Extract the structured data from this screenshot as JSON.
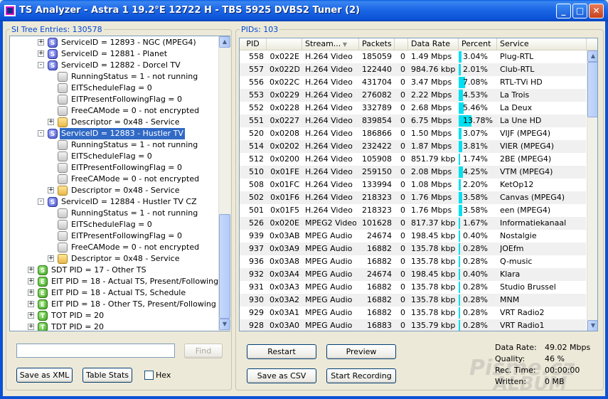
{
  "window": {
    "title": "TS Analyzer - Astra 1 19.2°E 12722 H - TBS 5925 DVBS2 Tuner (2)",
    "minimize": "_",
    "maximize": "□",
    "close": "✕"
  },
  "left_panel": {
    "label": "SI Tree Entries: 130578",
    "tree": [
      {
        "text": "ServiceID = 12893 - NGC (MPEG4)",
        "level": 1,
        "icon": "S",
        "expander": "+"
      },
      {
        "text": "ServiceID = 12881 - Planet",
        "level": 1,
        "icon": "S",
        "expander": "+"
      },
      {
        "text": "ServiceID = 12882 - Dorcel TV",
        "level": 1,
        "icon": "S",
        "expander": "-"
      },
      {
        "text": "RunningStatus = 1 - not running",
        "level": 2,
        "icon": "plain",
        "expander": ""
      },
      {
        "text": "EITScheduleFlag = 0",
        "level": 2,
        "icon": "plain",
        "expander": ""
      },
      {
        "text": "EITPresentFollowingFlag = 0",
        "level": 2,
        "icon": "plain",
        "expander": ""
      },
      {
        "text": "FreeCAMode = 0 - not encrypted",
        "level": 2,
        "icon": "plain",
        "expander": ""
      },
      {
        "text": "Descriptor = 0x48 - Service",
        "level": 2,
        "icon": "folder",
        "expander": "+"
      },
      {
        "text": "ServiceID = 12883 - Hustler TV",
        "level": 1,
        "icon": "S",
        "expander": "-",
        "selected": true
      },
      {
        "text": "RunningStatus = 1 - not running",
        "level": 2,
        "icon": "plain",
        "expander": ""
      },
      {
        "text": "EITScheduleFlag = 0",
        "level": 2,
        "icon": "plain",
        "expander": ""
      },
      {
        "text": "EITPresentFollowingFlag = 0",
        "level": 2,
        "icon": "plain",
        "expander": ""
      },
      {
        "text": "FreeCAMode = 0 - not encrypted",
        "level": 2,
        "icon": "plain",
        "expander": ""
      },
      {
        "text": "Descriptor = 0x48 - Service",
        "level": 2,
        "icon": "folder",
        "expander": "+"
      },
      {
        "text": "ServiceID = 12884 - Hustler TV CZ",
        "level": 1,
        "icon": "S",
        "expander": "-"
      },
      {
        "text": "RunningStatus = 1 - not running",
        "level": 2,
        "icon": "plain",
        "expander": ""
      },
      {
        "text": "EITScheduleFlag = 0",
        "level": 2,
        "icon": "plain",
        "expander": ""
      },
      {
        "text": "EITPresentFollowingFlag = 0",
        "level": 2,
        "icon": "plain",
        "expander": ""
      },
      {
        "text": "FreeCAMode = 0 - not encrypted",
        "level": 2,
        "icon": "plain",
        "expander": ""
      },
      {
        "text": "Descriptor = 0x48 - Service",
        "level": 2,
        "icon": "folder",
        "expander": "+"
      },
      {
        "text": "SDT PID = 17 - Other TS",
        "level": 0,
        "icon": "S",
        "iconColor": "green",
        "expander": "+"
      },
      {
        "text": "EIT PID = 18 - Actual TS, Present/Following",
        "level": 0,
        "icon": "E",
        "iconColor": "green",
        "expander": "+"
      },
      {
        "text": "EIT PID = 18 - Actual TS, Schedule",
        "level": 0,
        "icon": "E",
        "iconColor": "green",
        "expander": "+"
      },
      {
        "text": "EIT PID = 18 - Other TS, Present/Following",
        "level": 0,
        "icon": "E",
        "iconColor": "green",
        "expander": "+"
      },
      {
        "text": "TOT PID = 20",
        "level": 0,
        "icon": "T",
        "iconColor": "green",
        "expander": "+"
      },
      {
        "text": "TDT PID = 20",
        "level": 0,
        "icon": "T",
        "iconColor": "green",
        "expander": "+"
      }
    ],
    "search_value": "",
    "find_label": "Find",
    "save_xml_label": "Save as XML",
    "table_stats_label": "Table Stats",
    "hex_label": "Hex"
  },
  "right_panel": {
    "label": "PIDs: 103",
    "columns": [
      "PID",
      "",
      "Stream...",
      "Packets",
      "",
      "Data Rate",
      "Percent",
      "Service"
    ],
    "rows": [
      {
        "pid": "558",
        "hex": "0x022E",
        "stream": "H.264 Video",
        "packets": "185059",
        "cc": "0",
        "rate": "1.49 Mbps",
        "percent": "3.04%",
        "pct": 3.04,
        "service": "Plug-RTL"
      },
      {
        "pid": "557",
        "hex": "0x022D",
        "stream": "H.264 Video",
        "packets": "122440",
        "cc": "0",
        "rate": "984.76 kbps",
        "percent": "2.01%",
        "pct": 2.01,
        "service": "Club-RTL"
      },
      {
        "pid": "556",
        "hex": "0x022C",
        "stream": "H.264 Video",
        "packets": "431704",
        "cc": "0",
        "rate": "3.47 Mbps",
        "percent": "7.08%",
        "pct": 7.08,
        "service": "RTL-TVi HD"
      },
      {
        "pid": "553",
        "hex": "0x0229",
        "stream": "H.264 Video",
        "packets": "276082",
        "cc": "0",
        "rate": "2.22 Mbps",
        "percent": "4.53%",
        "pct": 4.53,
        "service": "La Trois"
      },
      {
        "pid": "552",
        "hex": "0x0228",
        "stream": "H.264 Video",
        "packets": "332789",
        "cc": "0",
        "rate": "2.68 Mbps",
        "percent": "5.46%",
        "pct": 5.46,
        "service": "La Deux"
      },
      {
        "pid": "551",
        "hex": "0x0227",
        "stream": "H.264 Video",
        "packets": "839854",
        "cc": "0",
        "rate": "6.75 Mbps",
        "percent": "13.78%",
        "pct": 13.78,
        "service": "La Une HD"
      },
      {
        "pid": "520",
        "hex": "0x0208",
        "stream": "H.264 Video",
        "packets": "186866",
        "cc": "0",
        "rate": "1.50 Mbps",
        "percent": "3.07%",
        "pct": 3.07,
        "service": "VIJF (MPEG4)"
      },
      {
        "pid": "514",
        "hex": "0x0202",
        "stream": "H.264 Video",
        "packets": "232422",
        "cc": "0",
        "rate": "1.87 Mbps",
        "percent": "3.81%",
        "pct": 3.81,
        "service": "VIER (MPEG4)"
      },
      {
        "pid": "512",
        "hex": "0x0200",
        "stream": "H.264 Video",
        "packets": "105908",
        "cc": "0",
        "rate": "851.79 kbps",
        "percent": "1.74%",
        "pct": 1.74,
        "service": "2BE (MPEG4)"
      },
      {
        "pid": "510",
        "hex": "0x01FE",
        "stream": "H.264 Video",
        "packets": "259150",
        "cc": "0",
        "rate": "2.08 Mbps",
        "percent": "4.25%",
        "pct": 4.25,
        "service": "VTM (MPEG4)"
      },
      {
        "pid": "508",
        "hex": "0x01FC",
        "stream": "H.264 Video",
        "packets": "133994",
        "cc": "0",
        "rate": "1.08 Mbps",
        "percent": "2.20%",
        "pct": 2.2,
        "service": "KetOp12"
      },
      {
        "pid": "502",
        "hex": "0x01F6",
        "stream": "H.264 Video",
        "packets": "218323",
        "cc": "0",
        "rate": "1.76 Mbps",
        "percent": "3.58%",
        "pct": 3.58,
        "service": "Canvas (MPEG4)"
      },
      {
        "pid": "501",
        "hex": "0x01F5",
        "stream": "H.264 Video",
        "packets": "218323",
        "cc": "0",
        "rate": "1.76 Mbps",
        "percent": "3.58%",
        "pct": 3.58,
        "service": "een (MPEG4)"
      },
      {
        "pid": "526",
        "hex": "0x020E",
        "stream": "MPEG2 Video",
        "packets": "101628",
        "cc": "0",
        "rate": "817.37 kbps",
        "percent": "1.67%",
        "pct": 1.67,
        "service": "Informatiekanaal"
      },
      {
        "pid": "939",
        "hex": "0x03AB",
        "stream": "MPEG Audio",
        "packets": "24674",
        "cc": "0",
        "rate": "198.45 kbps",
        "percent": "0.40%",
        "pct": 0.4,
        "service": "Nostalgie"
      },
      {
        "pid": "937",
        "hex": "0x03A9",
        "stream": "MPEG Audio",
        "packets": "16882",
        "cc": "0",
        "rate": "135.78 kbps",
        "percent": "0.28%",
        "pct": 0.28,
        "service": "JOEfm"
      },
      {
        "pid": "936",
        "hex": "0x03A8",
        "stream": "MPEG Audio",
        "packets": "16882",
        "cc": "0",
        "rate": "135.78 kbps",
        "percent": "0.28%",
        "pct": 0.28,
        "service": "Q-music"
      },
      {
        "pid": "932",
        "hex": "0x03A4",
        "stream": "MPEG Audio",
        "packets": "24674",
        "cc": "0",
        "rate": "198.45 kbps",
        "percent": "0.40%",
        "pct": 0.4,
        "service": "Klara"
      },
      {
        "pid": "931",
        "hex": "0x03A3",
        "stream": "MPEG Audio",
        "packets": "16882",
        "cc": "0",
        "rate": "135.78 kbps",
        "percent": "0.28%",
        "pct": 0.28,
        "service": "Studio Brussel"
      },
      {
        "pid": "930",
        "hex": "0x03A2",
        "stream": "MPEG Audio",
        "packets": "16882",
        "cc": "0",
        "rate": "135.78 kbps",
        "percent": "0.28%",
        "pct": 0.28,
        "service": "MNM"
      },
      {
        "pid": "929",
        "hex": "0x03A1",
        "stream": "MPEG Audio",
        "packets": "16882",
        "cc": "0",
        "rate": "135.78 kbps",
        "percent": "0.28%",
        "pct": 0.28,
        "service": "VRT Radio2"
      },
      {
        "pid": "928",
        "hex": "0x03A0",
        "stream": "MPEG Audio",
        "packets": "16883",
        "cc": "0",
        "rate": "135.79 kbps",
        "percent": "0.28%",
        "pct": 0.28,
        "service": "VRT Radio1"
      }
    ],
    "restart_label": "Restart",
    "preview_label": "Preview",
    "save_csv_label": "Save as CSV",
    "start_recording_label": "Start Recording",
    "stats": {
      "data_rate_label": "Data Rate:",
      "data_rate_value": "49.02 Mbps",
      "quality_label": "Quality:",
      "quality_value": "46 %",
      "rec_time_label": "Rec. Time:",
      "rec_time_value": "00:00:00",
      "written_label": "Written:",
      "written_value": "0 MB"
    }
  },
  "watermark": {
    "line1": "Pisme.cz",
    "line2": "ALBUM"
  },
  "colors": {
    "selection": "#316ac5",
    "percent_bar": "#00e0f0",
    "label_blue": "#0046d5"
  }
}
